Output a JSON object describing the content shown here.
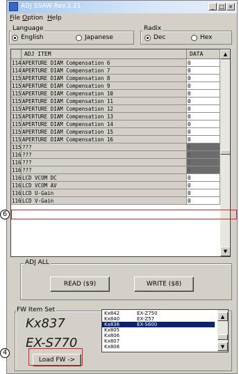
{
  "window": {
    "title": "ADJ SSAW Rev.1.21",
    "minimize": "_",
    "maximize": "□",
    "close": "×"
  },
  "menu": [
    {
      "underline": "F",
      "rest": "ile"
    },
    {
      "underline": "O",
      "rest": "ption"
    },
    {
      "underline": "H",
      "rest": "elp"
    }
  ],
  "language": {
    "label": "Language",
    "options": [
      "English",
      "Japanese"
    ],
    "selected": "English"
  },
  "radix": {
    "label": "Radix",
    "options": [
      "Dec",
      "Hex"
    ],
    "selected": "Dec"
  },
  "grid": {
    "headers": [
      "ADJ ITEM",
      "DATA"
    ],
    "rows": [
      {
        "idx": "1148",
        "item": "APERTURE DIAM Compensation 6",
        "data": "0"
      },
      {
        "idx": "1149",
        "item": "APERTURE DIAM Compensation 7",
        "data": "0"
      },
      {
        "idx": "1150",
        "item": "APERTURE DIAM Compensation 8",
        "data": "0"
      },
      {
        "idx": "1151",
        "item": "APERTURE DIAM Compensation 9",
        "data": "0"
      },
      {
        "idx": "1152",
        "item": "APERTURE DIAM Compensation 10",
        "data": "0"
      },
      {
        "idx": "1153",
        "item": "APERTURE DIAM Compensation 11",
        "data": "0"
      },
      {
        "idx": "1154",
        "item": "APERTURE DIAM Compensation 12",
        "data": "0"
      },
      {
        "idx": "1155",
        "item": "APERTURE DIAM Compensation 13",
        "data": "0"
      },
      {
        "idx": "1156",
        "item": "APERTURE DIAM Compensation 14",
        "data": "0"
      },
      {
        "idx": "1157",
        "item": "APERTURE DIAM Compensation 15",
        "data": "0"
      },
      {
        "idx": "1158",
        "item": "APERTURE DIAM Compensation 16",
        "data": "0"
      },
      {
        "idx": "1159",
        "item": "???",
        "data": "0",
        "dark": true
      },
      {
        "idx": "1160",
        "item": "???",
        "data": "0",
        "dark": true
      },
      {
        "idx": "1161",
        "item": "???",
        "data": "0",
        "dark": true
      },
      {
        "idx": "1162",
        "item": "???",
        "data": "0",
        "dark": true
      },
      {
        "idx": "1163",
        "item": "LCD VCOM DC",
        "data": "0"
      },
      {
        "idx": "1164",
        "item": "LCD VCOM AV",
        "data": "0"
      },
      {
        "idx": "1165",
        "item": "LCD U-Gain",
        "data": "0"
      },
      {
        "idx": "1166",
        "item": "LCD V-Gain",
        "data": "0"
      }
    ]
  },
  "scroll": {
    "up": "▲",
    "down": "▼"
  },
  "adj_all": {
    "label": "ADJ ALL",
    "read": "READ ($9)",
    "write": "WRITE ($8)"
  },
  "fw_set": {
    "label": "FW Item Set",
    "model_code": "Kx837",
    "model_name": "EX-S770",
    "load_button": "Load FW ->",
    "list": [
      {
        "code": "Kx842",
        "name": "EX-Z750"
      },
      {
        "code": "Kx840",
        "name": "EX-Z57"
      },
      {
        "code": "Kx836",
        "name": "EX-S600",
        "selected": true
      },
      {
        "code": "Kx805",
        "name": ""
      },
      {
        "code": "Kx806",
        "name": ""
      },
      {
        "code": "Kx807",
        "name": ""
      },
      {
        "code": "Kx808",
        "name": ""
      }
    ]
  },
  "callouts": {
    "row": "6",
    "load": "4"
  }
}
